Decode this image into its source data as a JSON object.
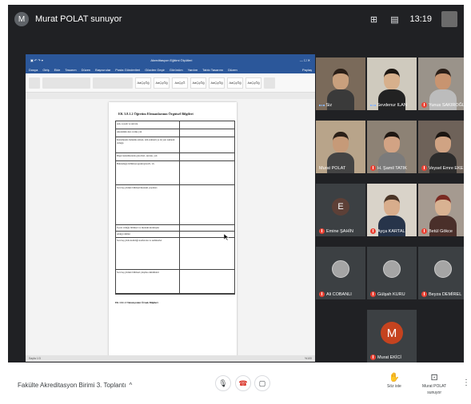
{
  "presenter": {
    "name": "Murat POLAT sunuyor",
    "initial": "M"
  },
  "topbar": {
    "time": "13:19"
  },
  "document": {
    "title": "Akreditasyon Eğitimi Ölçütleri",
    "menus": [
      "Dosya",
      "Giriş",
      "Ekle",
      "Tasarım",
      "Düzen",
      "Başvurular",
      "Posta Gönderileri",
      "Gözden Geçir",
      "Görünüm",
      "Yardım",
      "Tablo Tasarımı",
      "Düzen",
      "Paylaş"
    ],
    "heading": "EK 3.8.1.2 Öğretim Elemanlarının Örgütsel Bilgileri",
    "rows": [
      {
        "label": "Adı, soyadı ve unvanı",
        "h": 10
      },
      {
        "label": "Akademik ders verme yılı",
        "h": 10
      },
      {
        "label": "Kurumunda bulunma süresi, tam zamanlı ya da yarı zamanlı olduğu",
        "h": 20
      },
      {
        "label": "Diğer kurumlarında görevleri, unvanı, yılı",
        "h": 10
      },
      {
        "label": "Bulunduğu bölüm/program/görevli, vb.",
        "h": 30
      },
      {
        "label": "Son beş yıldaki bilimsel/mesleki yayınları",
        "h": 50
      },
      {
        "label": "Üyesi olduğu bilimsel ve mesleki kuruluşlar",
        "h": 8
      },
      {
        "label": "Aldığı ödüller",
        "h": 8
      },
      {
        "label": "Son beş yılda katıldığı konferans ve seminerler",
        "h": 40
      },
      {
        "label": "Son beş yıldaki bilimsel çalışma etkinlikleri",
        "h": 30
      }
    ],
    "footer": "EK 3.8.1.3 Teknisyenler Örnek Bilgileri",
    "status_left": "Sayfa 1/3",
    "status_right": "%100"
  },
  "participants": [
    {
      "name": "Siz",
      "dots": true,
      "mic_off": false
    },
    {
      "name": "Sevdenur İLAN",
      "dots": true,
      "mic_off": false
    },
    {
      "name": "Yunus SAKIROĞLU",
      "dots": false,
      "mic_off": true
    },
    {
      "name": "Murat POLAT",
      "dots": false,
      "mic_off": false
    },
    {
      "name": "H. Şamil TATIK",
      "dots": false,
      "mic_off": true
    },
    {
      "name": "Veysel Emre EKE",
      "dots": false,
      "mic_off": true
    },
    {
      "name": "Emine ŞAHİN",
      "initial": "E",
      "dots": false,
      "mic_off": true
    },
    {
      "name": "Ayça KARTAL",
      "dots": false,
      "mic_off": true
    },
    {
      "name": "Betül Gökce",
      "dots": false,
      "mic_off": true
    },
    {
      "name": "Ali COBANLI",
      "dots": false,
      "mic_off": true
    },
    {
      "name": "Gülşah KURU",
      "dots": false,
      "mic_off": true
    },
    {
      "name": "Beyza DEMİREL",
      "dots": false,
      "mic_off": true
    },
    {
      "name": "Murat EKİCİ",
      "initial": "M",
      "dots": false,
      "mic_off": true
    }
  ],
  "colors": {
    "emine_avatar": "#5d4037",
    "ekici_avatar": "#c5431f",
    "mic_off": "#ea4335",
    "end_call": "#d93025"
  },
  "bottombar": {
    "meeting_title": "Fakülte Akreditasyon Birimi 3. Toplantı",
    "raise_hand_label": "Söz iste",
    "presenting_label_1": "Murat POLAT",
    "presenting_label_2": "sunuyor"
  },
  "icons": {
    "mic": "microphone-icon",
    "end": "end-call-icon",
    "cam": "camera-off-icon",
    "hand": "raise-hand-icon",
    "present": "present-icon",
    "more": "more-vert-icon"
  }
}
